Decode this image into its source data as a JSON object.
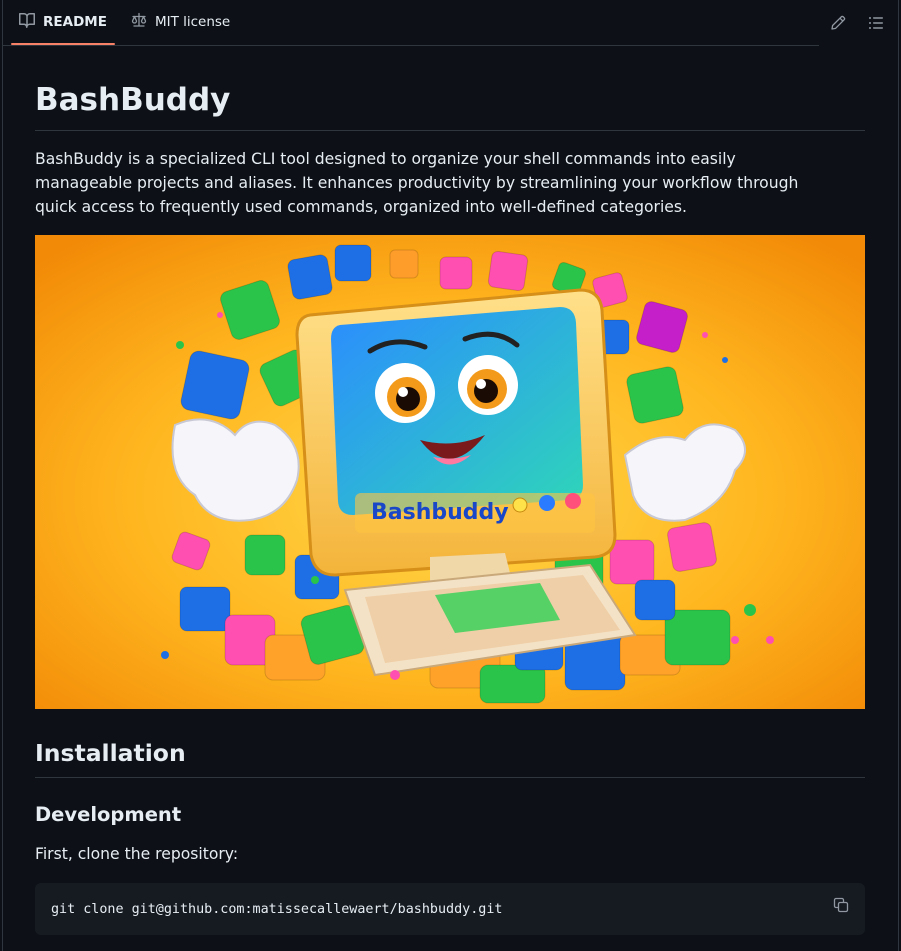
{
  "tabs": [
    {
      "label": "README",
      "icon": "book-icon",
      "active": true
    },
    {
      "label": "MIT license",
      "icon": "scale-icon",
      "active": false
    }
  ],
  "actions": {
    "edit_icon": "pencil-icon",
    "outline_icon": "list-icon"
  },
  "readme": {
    "title": "BashBuddy",
    "description": "BashBuddy is a specialized CLI tool designed to organize your shell commands into easily manageable projects and aliases. It enhances productivity by streamlining your workflow through quick access to frequently used commands, organized into well-defined categories.",
    "hero_logo_text": "Bashbuddy",
    "installation_heading": "Installation",
    "development_heading": "Development",
    "step_text": "First, clone the repository:",
    "code": "git clone git@github.com:matissecallewaert/bashbuddy.git"
  },
  "colors": {
    "accent": "#f78166",
    "background": "#0d1117",
    "code_bg": "#161b22",
    "border": "#30363d"
  }
}
